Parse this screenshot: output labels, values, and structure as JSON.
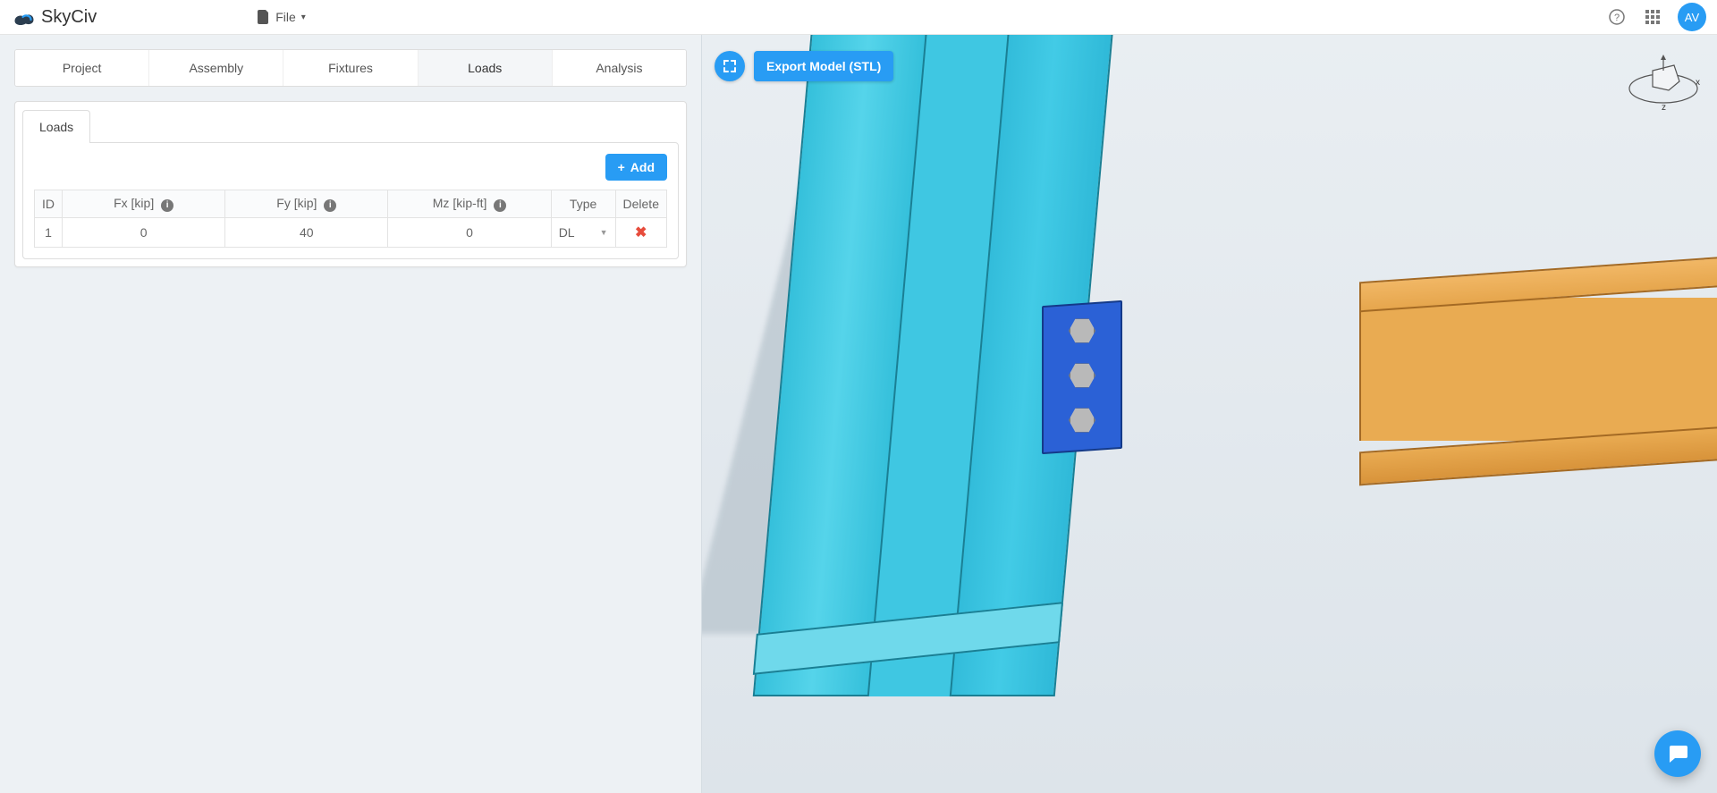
{
  "brand": "SkyCiv",
  "file_menu_label": "File",
  "avatar_initials": "AV",
  "tabs": {
    "project": "Project",
    "assembly": "Assembly",
    "fixtures": "Fixtures",
    "loads": "Loads",
    "analysis": "Analysis"
  },
  "subtab_label": "Loads",
  "add_button_label": "Add",
  "table": {
    "headers": {
      "id": "ID",
      "fx": "Fx [kip]",
      "fy": "Fy [kip]",
      "mz": "Mz [kip-ft]",
      "type": "Type",
      "delete": "Delete"
    },
    "rows": [
      {
        "id": "1",
        "fx": "0",
        "fy": "40",
        "mz": "0",
        "type": "DL"
      }
    ]
  },
  "viewport": {
    "export_label": "Export Model (STL)",
    "axis_x": "x",
    "axis_z": "z"
  },
  "info_glyph": "i"
}
